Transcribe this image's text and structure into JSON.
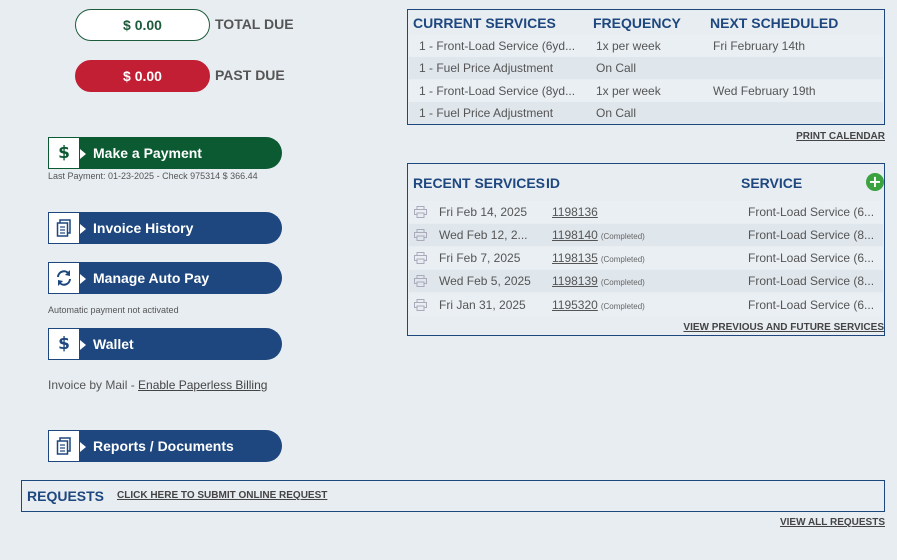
{
  "balances": {
    "total_due_amount": "$ 0.00",
    "total_due_label": "TOTAL DUE",
    "past_due_amount": "$ 0.00",
    "past_due_label": "PAST DUE"
  },
  "actions": {
    "make_payment": "Make a Payment",
    "last_payment": "Last Payment: 01-23-2025 - Check 975314  $ 366.44",
    "invoice_history": "Invoice History",
    "manage_auto_pay": "Manage Auto Pay",
    "auto_pay_note": "Automatic payment not activated",
    "wallet": "Wallet",
    "invoice_by_mail": "Invoice by Mail - ",
    "enable_paperless": "Enable Paperless Billing",
    "reports_documents": "Reports / Documents"
  },
  "current_services": {
    "headers": {
      "service": "CURRENT SERVICES",
      "frequency": "FREQUENCY",
      "next": "NEXT SCHEDULED"
    },
    "rows": [
      {
        "service": "1 - Front-Load Service (6yd...",
        "frequency": "1x per week",
        "next": "Fri February 14th"
      },
      {
        "service": "1 - Fuel Price Adjustment",
        "frequency": "On Call",
        "next": ""
      },
      {
        "service": "1 - Front-Load Service (8yd...",
        "frequency": "1x per week",
        "next": "Wed February 19th"
      },
      {
        "service": "1 - Fuel Price Adjustment",
        "frequency": "On Call",
        "next": ""
      }
    ],
    "print_calendar": "PRINT CALENDAR"
  },
  "recent_services": {
    "headers": {
      "service": "RECENT SERVICES",
      "id": "ID",
      "type": "SERVICE"
    },
    "rows": [
      {
        "date": "Fri Feb 14, 2025",
        "id": "1198136",
        "status": "",
        "type": "Front-Load Service (6..."
      },
      {
        "date": "Wed Feb 12, 2...",
        "id": "1198140",
        "status": "(Completed)",
        "type": "Front-Load Service (8..."
      },
      {
        "date": "Fri Feb 7, 2025",
        "id": "1198135",
        "status": "(Completed)",
        "type": "Front-Load Service (6..."
      },
      {
        "date": "Wed Feb 5, 2025",
        "id": "1198139",
        "status": "(Completed)",
        "type": "Front-Load Service (8..."
      },
      {
        "date": "Fri Jan 31, 2025",
        "id": "1195320",
        "status": "(Completed)",
        "type": "Front-Load Service (6..."
      }
    ],
    "view_link": "VIEW PREVIOUS AND FUTURE SERVICES"
  },
  "requests": {
    "title": "REQUESTS",
    "submit_link": "CLICK HERE TO SUBMIT ONLINE REQUEST",
    "view_all": "VIEW ALL REQUESTS"
  }
}
